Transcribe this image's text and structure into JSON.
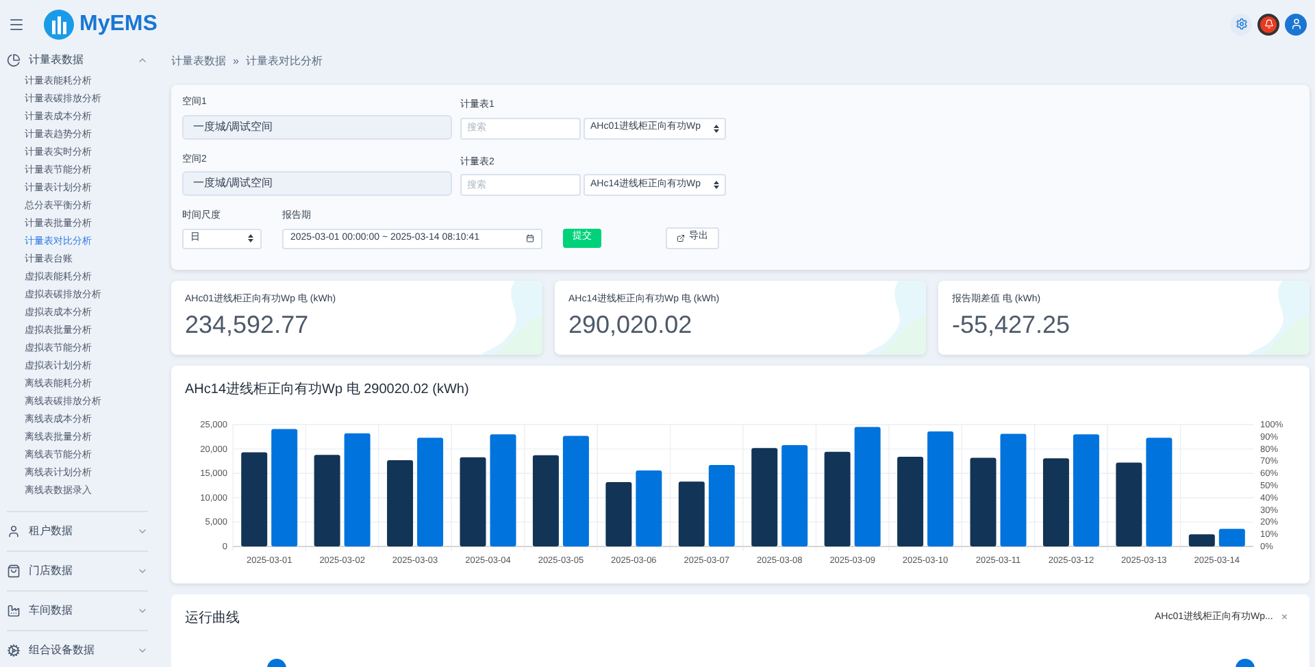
{
  "header": {
    "brand": "MyEMS"
  },
  "sidebar": {
    "groups": [
      {
        "label": "计量表数据",
        "expanded": true,
        "items": [
          {
            "label": "计量表能耗分析",
            "selected": false
          },
          {
            "label": "计量表碳排放分析",
            "selected": false
          },
          {
            "label": "计量表成本分析",
            "selected": false
          },
          {
            "label": "计量表趋势分析",
            "selected": false
          },
          {
            "label": "计量表实时分析",
            "selected": false
          },
          {
            "label": "计量表节能分析",
            "selected": false
          },
          {
            "label": "计量表计划分析",
            "selected": false
          },
          {
            "label": "总分表平衡分析",
            "selected": false
          },
          {
            "label": "计量表批量分析",
            "selected": false
          },
          {
            "label": "计量表对比分析",
            "selected": true
          },
          {
            "label": "计量表台账",
            "selected": false
          },
          {
            "label": "虚拟表能耗分析",
            "selected": false
          },
          {
            "label": "虚拟表碳排放分析",
            "selected": false
          },
          {
            "label": "虚拟表成本分析",
            "selected": false
          },
          {
            "label": "虚拟表批量分析",
            "selected": false
          },
          {
            "label": "虚拟表节能分析",
            "selected": false
          },
          {
            "label": "虚拟表计划分析",
            "selected": false
          },
          {
            "label": "离线表能耗分析",
            "selected": false
          },
          {
            "label": "离线表碳排放分析",
            "selected": false
          },
          {
            "label": "离线表成本分析",
            "selected": false
          },
          {
            "label": "离线表批量分析",
            "selected": false
          },
          {
            "label": "离线表节能分析",
            "selected": false
          },
          {
            "label": "离线表计划分析",
            "selected": false
          },
          {
            "label": "离线表数据录入",
            "selected": false
          }
        ]
      },
      {
        "label": "租户数据",
        "expanded": false
      },
      {
        "label": "门店数据",
        "expanded": false
      },
      {
        "label": "车间数据",
        "expanded": false
      },
      {
        "label": "组合设备数据",
        "expanded": false
      }
    ]
  },
  "breadcrumb": [
    "计量表数据",
    "»",
    "计量表对比分析"
  ],
  "form": {
    "space1": {
      "label": "空间1",
      "value": "一度城/调试空间"
    },
    "meter1": {
      "label": "计量表1",
      "placeholder": "搜索",
      "value": "AHc01进线柜正向有功Wp"
    },
    "space2": {
      "label": "空间2",
      "value": "一度城/调试空间"
    },
    "meter2": {
      "label": "计量表2",
      "placeholder": "搜索",
      "value": "AHc14进线柜正向有功Wp"
    },
    "period_type": {
      "label": "时间尺度",
      "value": "日"
    },
    "report_period": {
      "label": "报告期",
      "value": "2025-03-01 00:00:00 ~ 2025-03-14 08:10:41"
    },
    "submit": "提交",
    "export": "导出"
  },
  "cards": [
    {
      "label": "AHc01进线柜正向有功Wp 电 (kWh)",
      "value": "234,592.77"
    },
    {
      "label": "AHc14进线柜正向有功Wp 电 (kWh)",
      "value": "290,020.02"
    },
    {
      "label": "报告期差值 电 (kWh)",
      "value": "-55,427.25"
    }
  ],
  "bar_chart": {
    "title": "AHc14进线柜正向有功Wp 电 290020.02 (kWh)",
    "chart_data": {
      "type": "bar",
      "categories": [
        "2025-03-01",
        "2025-03-02",
        "2025-03-03",
        "2025-03-04",
        "2025-03-05",
        "2025-03-06",
        "2025-03-07",
        "2025-03-08",
        "2025-03-09",
        "2025-03-10",
        "2025-03-11",
        "2025-03-12",
        "2025-03-13",
        "2025-03-14"
      ],
      "series": [
        {
          "color": "#123456",
          "values": [
            19300,
            18800,
            17700,
            18300,
            18700,
            13200,
            13300,
            20200,
            19400,
            18400,
            18200,
            18100,
            17200,
            2500
          ]
        },
        {
          "color": "#0073dd",
          "values": [
            24100,
            23200,
            22300,
            23000,
            22700,
            15600,
            16700,
            20800,
            24500,
            23600,
            23100,
            23000,
            22300,
            3600
          ]
        }
      ],
      "grid": true,
      "ylim": [
        0,
        25000
      ],
      "yticks": [
        {
          "value": 0,
          "label": "0"
        },
        {
          "value": 5000,
          "label": "5,000"
        },
        {
          "value": 10000,
          "label": "10,000"
        },
        {
          "value": 15000,
          "label": "15,000"
        },
        {
          "value": 20000,
          "label": "20,000"
        },
        {
          "value": 25000,
          "label": "25,000"
        }
      ],
      "y2ticks": [
        "0%",
        "10%",
        "20%",
        "30%",
        "40%",
        "50%",
        "60%",
        "70%",
        "80%",
        "90%",
        "100%"
      ]
    }
  },
  "line_section": {
    "title": "运行曲线",
    "legend": "AHc01进线柜正向有功Wp...",
    "legend_close": "×"
  }
}
